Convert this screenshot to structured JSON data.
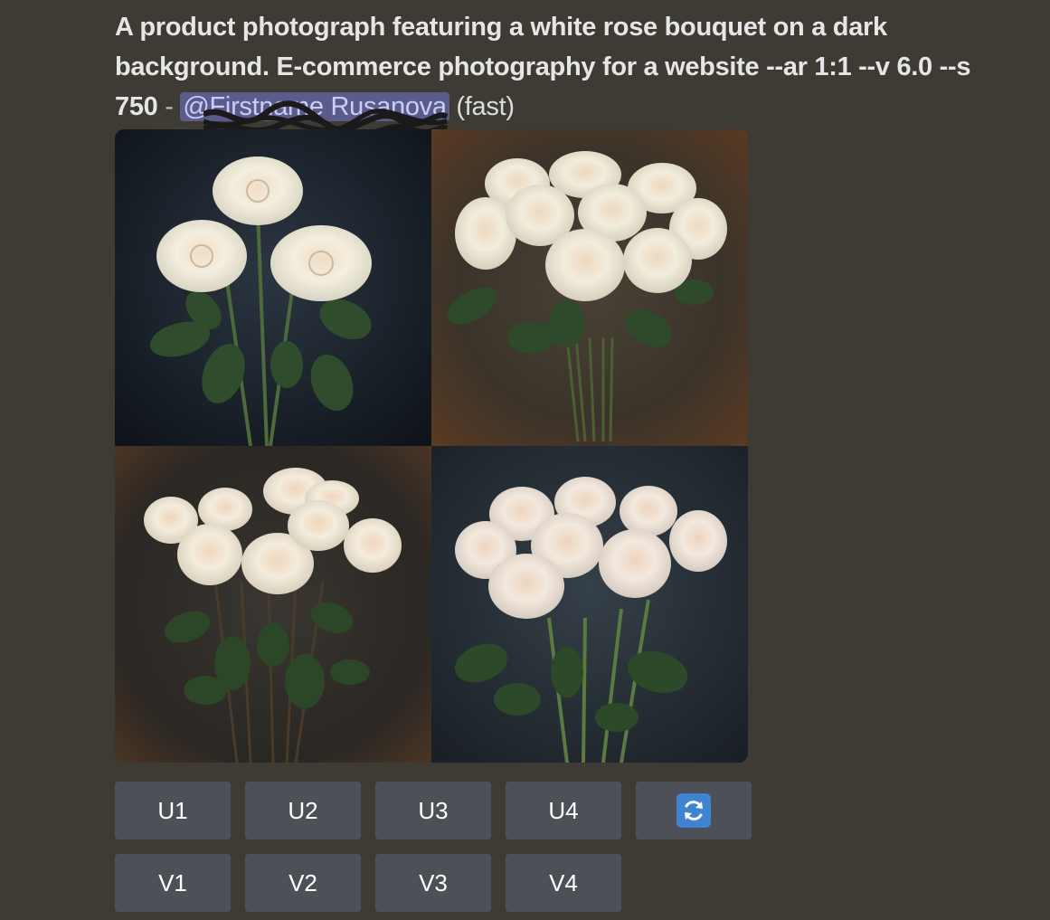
{
  "message": {
    "prompt": "A product photograph featuring a white rose bouquet on a dark background. E-commerce photography for a website --ar 1:1 --v 6.0 --s 750",
    "separator": " - ",
    "mention": "@Firstname Rusanova",
    "suffix": " (fast)"
  },
  "image_grid": {
    "tiles": [
      {
        "name": "roses-image-1",
        "background": "#1e2630",
        "roses": 3
      },
      {
        "name": "roses-image-2",
        "background": "#4a3a2c",
        "roses": 10
      },
      {
        "name": "roses-image-3",
        "background": "#2e2a26",
        "roses": 10
      },
      {
        "name": "roses-image-4",
        "background": "#26303a",
        "roses": 9
      }
    ]
  },
  "buttons": {
    "upscale": [
      "U1",
      "U2",
      "U3",
      "U4"
    ],
    "variation": [
      "V1",
      "V2",
      "V3",
      "V4"
    ],
    "reroll_icon": "refresh-icon"
  },
  "colors": {
    "background": "#3e3a34",
    "button": "#4e5058",
    "mention_bg": "#5b5c8a",
    "refresh_icon": "#3f84d1"
  }
}
